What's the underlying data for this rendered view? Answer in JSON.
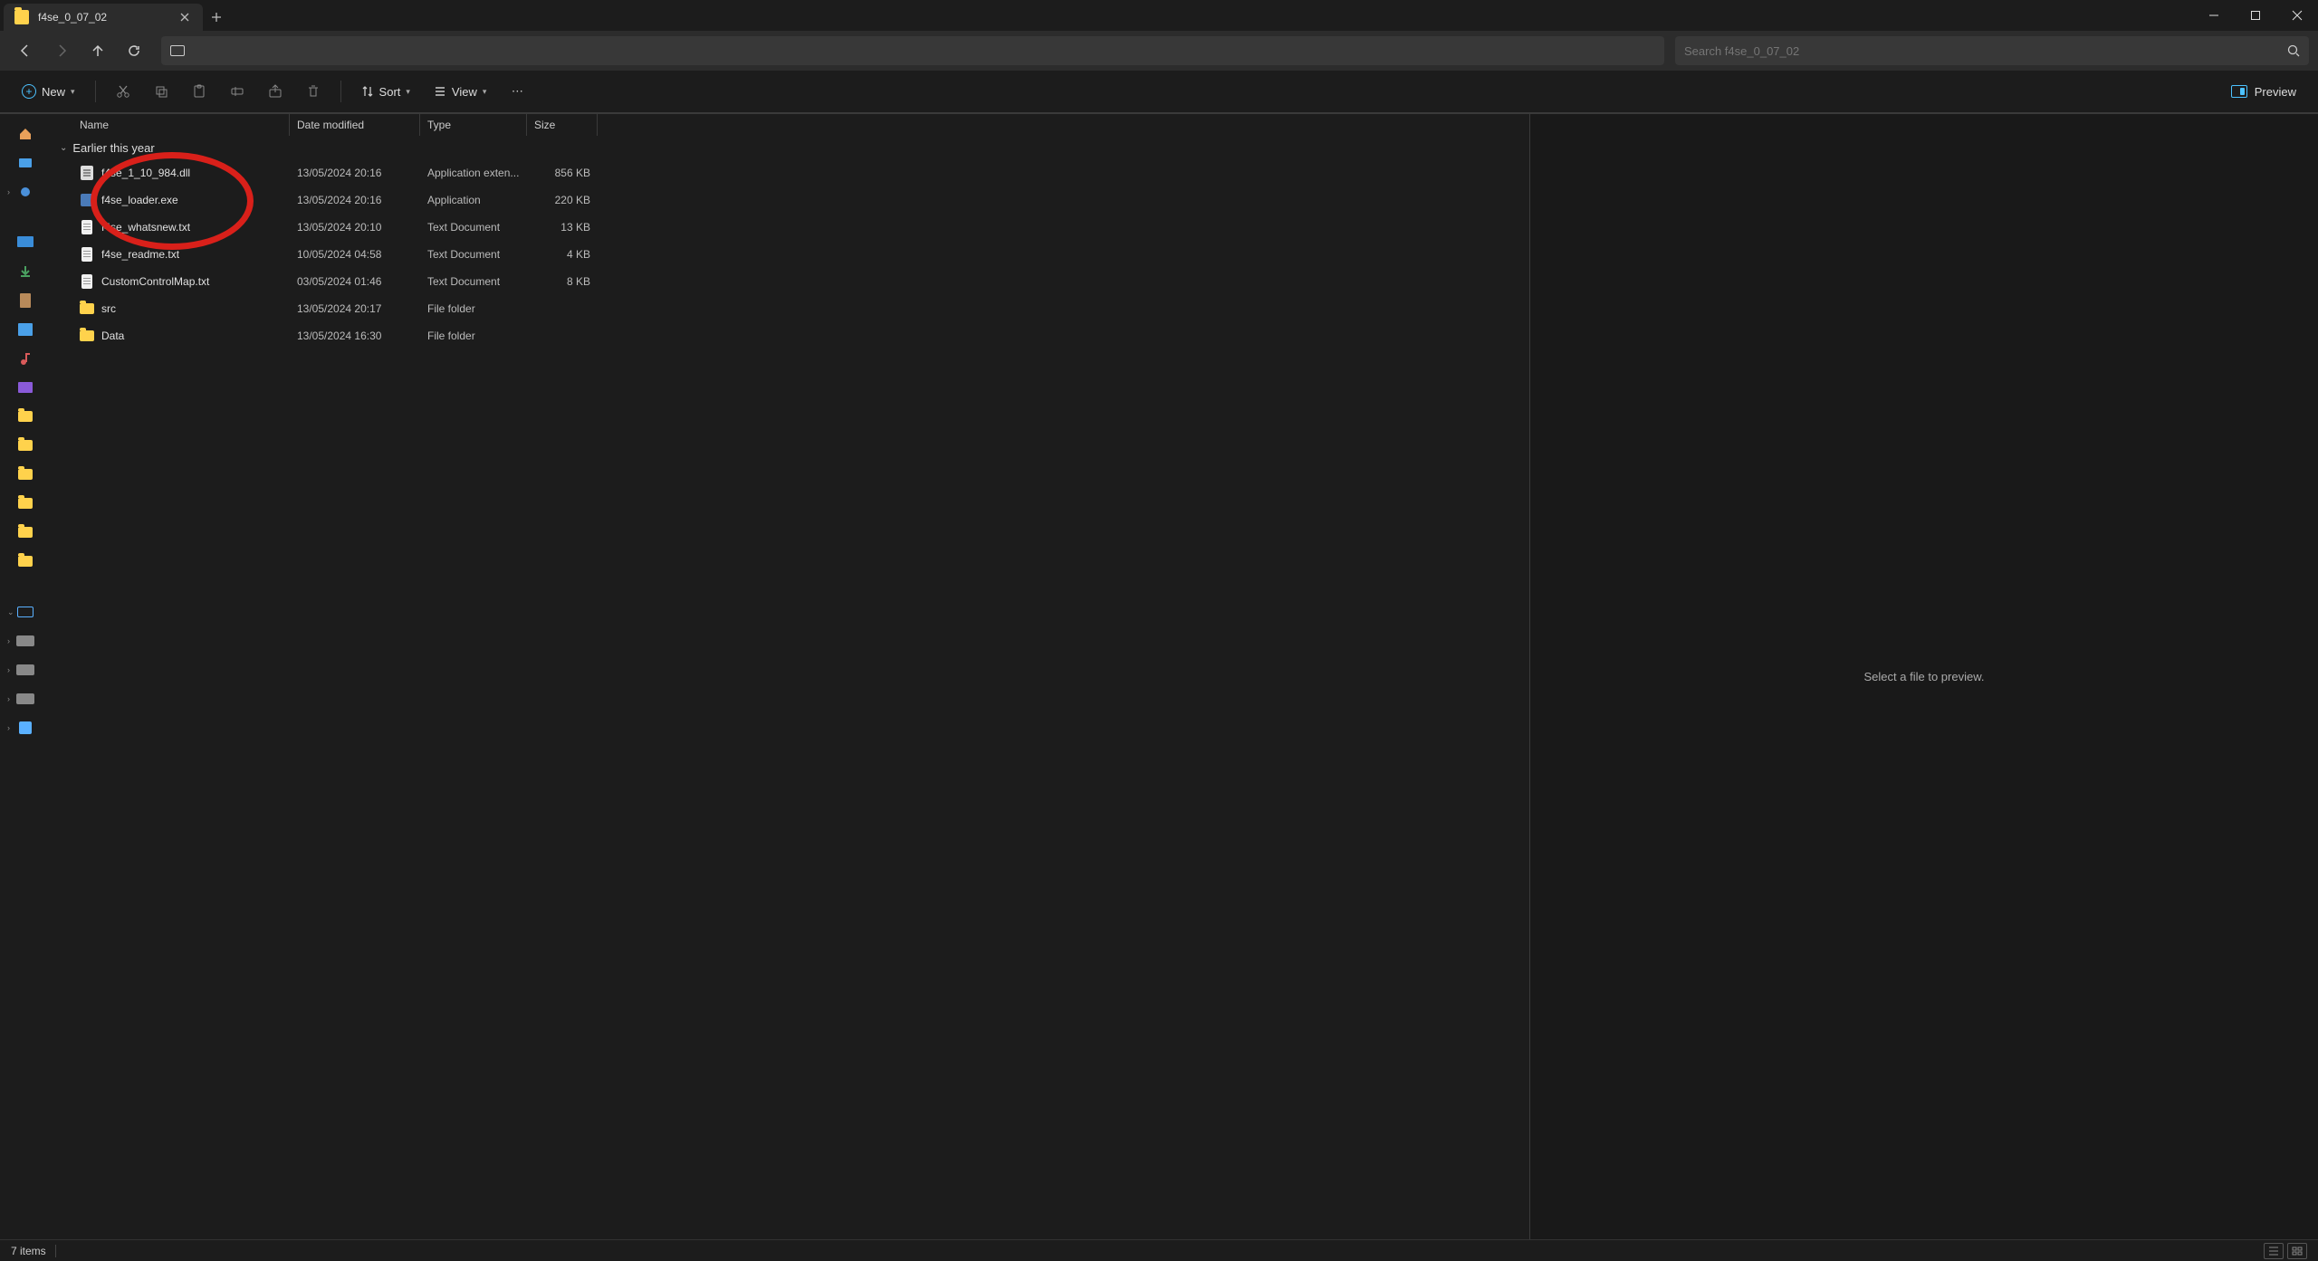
{
  "titlebar": {
    "tab_title": "f4se_0_07_02"
  },
  "nav": {
    "address": ""
  },
  "search": {
    "placeholder": "Search f4se_0_07_02"
  },
  "toolbar": {
    "new_label": "New",
    "sort_label": "Sort",
    "view_label": "View",
    "preview_label": "Preview"
  },
  "columns": {
    "name": "Name",
    "date": "Date modified",
    "type": "Type",
    "size": "Size"
  },
  "group": {
    "label": "Earlier this year"
  },
  "files": [
    {
      "name": "f4se_1_10_984.dll",
      "date": "13/05/2024 20:16",
      "type": "Application exten...",
      "size": "856 KB",
      "icon": "dll"
    },
    {
      "name": "f4se_loader.exe",
      "date": "13/05/2024 20:16",
      "type": "Application",
      "size": "220 KB",
      "icon": "exe"
    },
    {
      "name": "f4se_whatsnew.txt",
      "date": "13/05/2024 20:10",
      "type": "Text Document",
      "size": "13 KB",
      "icon": "txt"
    },
    {
      "name": "f4se_readme.txt",
      "date": "10/05/2024 04:58",
      "type": "Text Document",
      "size": "4 KB",
      "icon": "txt"
    },
    {
      "name": "CustomControlMap.txt",
      "date": "03/05/2024 01:46",
      "type": "Text Document",
      "size": "8 KB",
      "icon": "txt"
    },
    {
      "name": "src",
      "date": "13/05/2024 20:17",
      "type": "File folder",
      "size": "",
      "icon": "folder"
    },
    {
      "name": "Data",
      "date": "13/05/2024 16:30",
      "type": "File folder",
      "size": "",
      "icon": "folder"
    }
  ],
  "preview": {
    "empty_text": "Select a file to preview."
  },
  "status": {
    "item_count": "7 items"
  },
  "sidebar_icons": [
    "home",
    "gallery",
    "desktop",
    "downloads",
    "documents",
    "pictures",
    "music",
    "videos",
    "onedrive",
    "folder",
    "folder",
    "folder",
    "folder",
    "folder",
    "folder",
    "folder"
  ],
  "annotation": {
    "red_circle": true
  }
}
